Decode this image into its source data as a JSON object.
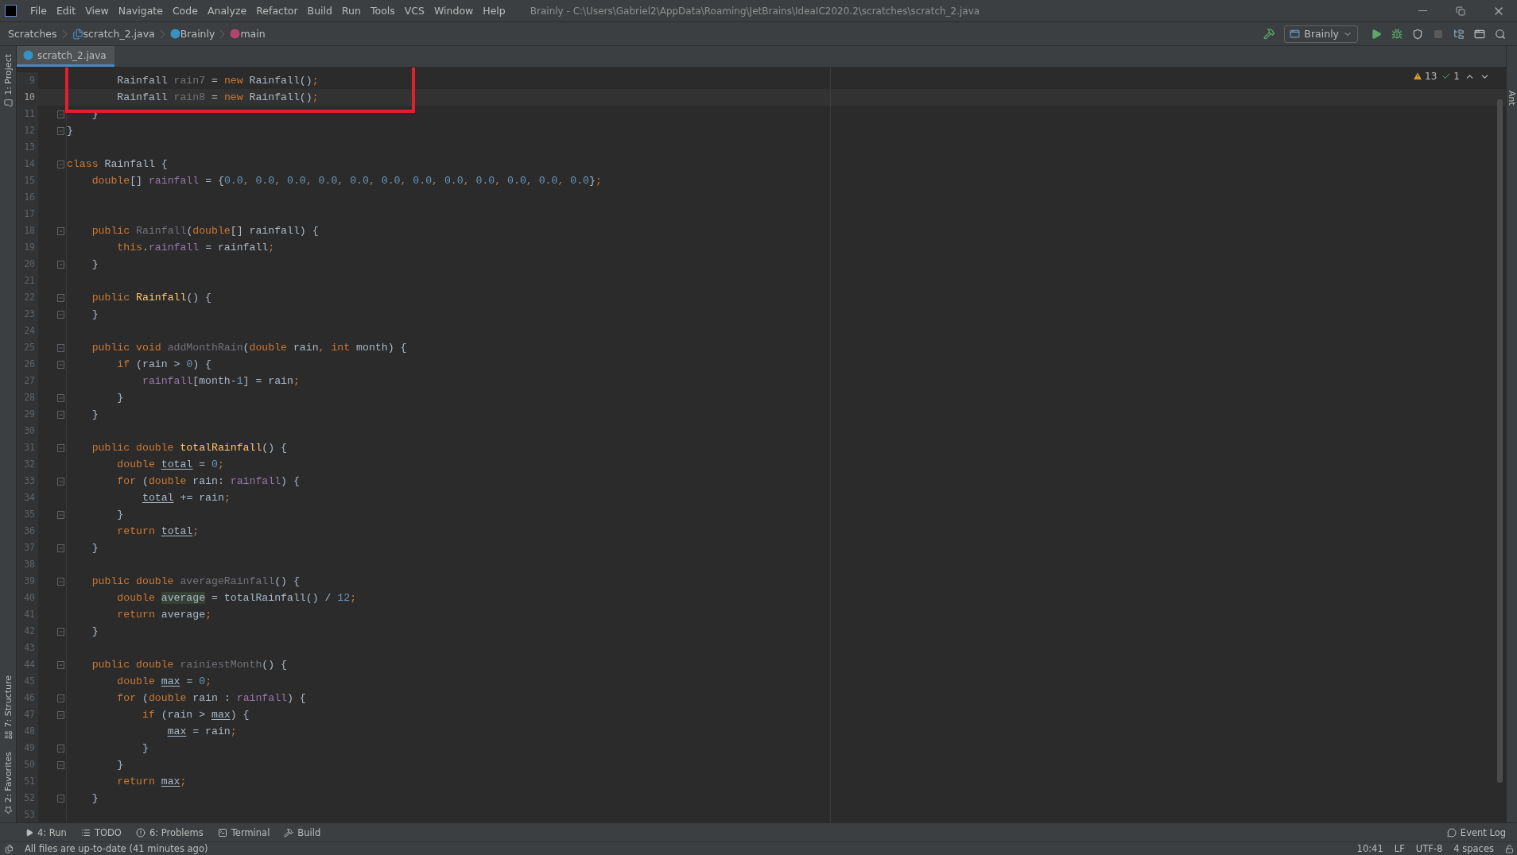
{
  "window": {
    "title": "Brainly - C:\\Users\\Gabriel2\\AppData\\Roaming\\JetBrains\\IdeaIC2020.2\\scratches\\scratch_2.java"
  },
  "menu": [
    "File",
    "Edit",
    "View",
    "Navigate",
    "Code",
    "Analyze",
    "Refactor",
    "Build",
    "Run",
    "Tools",
    "VCS",
    "Window",
    "Help"
  ],
  "breadcrumbs": [
    {
      "kind": "folder",
      "label": "Scratches"
    },
    {
      "kind": "file",
      "label": "scratch_2.java"
    },
    {
      "kind": "class",
      "label": "Brainly"
    },
    {
      "kind": "method",
      "label": "main"
    }
  ],
  "run_config": "Brainly",
  "tabs": [
    {
      "label": "scratch_2.java",
      "selected": true
    }
  ],
  "left_stripe": [
    {
      "kind": "top",
      "label": "1: Project"
    },
    {
      "kind": "bottom",
      "label": "7: Structure"
    },
    {
      "kind": "bottom",
      "label": "2: Favorites"
    }
  ],
  "right_stripe": [
    "Ant"
  ],
  "inspections": {
    "warnings": "13",
    "typos": "1"
  },
  "lines": [
    {
      "number": "9",
      "current": false,
      "fold": false,
      "tokens": [
        {
          "kind": "text",
          "text": "        Rainfall "
        },
        {
          "kind": "unused",
          "text": "rain7"
        },
        {
          "kind": "text",
          "text": " = "
        },
        {
          "kind": "keyword",
          "text": "new"
        },
        {
          "kind": "text",
          "text": " Rainfall()"
        },
        {
          "kind": "keyword",
          "text": ";"
        }
      ]
    },
    {
      "number": "10",
      "current": true,
      "fold": false,
      "tokens": [
        {
          "kind": "text",
          "text": "        Rainfall "
        },
        {
          "kind": "unused",
          "text": "rain8"
        },
        {
          "kind": "text",
          "text": " = "
        },
        {
          "kind": "keyword",
          "text": "new"
        },
        {
          "kind": "text",
          "text": " Rainfall()"
        },
        {
          "kind": "keyword",
          "text": ";"
        }
      ]
    },
    {
      "number": "11",
      "current": false,
      "fold": true,
      "tokens": [
        {
          "kind": "text",
          "text": "    }"
        }
      ]
    },
    {
      "number": "12",
      "current": false,
      "fold": true,
      "tokens": [
        {
          "kind": "text",
          "text": "}"
        }
      ]
    },
    {
      "number": "13",
      "current": false,
      "fold": false
    },
    {
      "number": "14",
      "current": false,
      "fold": true,
      "tokens": [
        {
          "kind": "keyword",
          "text": "class"
        },
        {
          "kind": "text",
          "text": " Rainfall {"
        }
      ]
    },
    {
      "number": "15",
      "current": false,
      "fold": false,
      "tokens": [
        {
          "kind": "keyword",
          "text": "    double"
        },
        {
          "kind": "text",
          "text": "[] "
        },
        {
          "kind": "field",
          "text": "rainfall"
        },
        {
          "kind": "text",
          "text": " = {"
        },
        {
          "kind": "number",
          "text": "0.0"
        },
        {
          "kind": "keyword",
          "text": ", "
        },
        {
          "kind": "number",
          "text": "0.0"
        },
        {
          "kind": "keyword",
          "text": ", "
        },
        {
          "kind": "number",
          "text": "0.0"
        },
        {
          "kind": "keyword",
          "text": ", "
        },
        {
          "kind": "number",
          "text": "0.0"
        },
        {
          "kind": "keyword",
          "text": ", "
        },
        {
          "kind": "number",
          "text": "0.0"
        },
        {
          "kind": "keyword",
          "text": ", "
        },
        {
          "kind": "number",
          "text": "0.0"
        },
        {
          "kind": "keyword",
          "text": ", "
        },
        {
          "kind": "number",
          "text": "0.0"
        },
        {
          "kind": "keyword",
          "text": ", "
        },
        {
          "kind": "number",
          "text": "0.0"
        },
        {
          "kind": "keyword",
          "text": ", "
        },
        {
          "kind": "number",
          "text": "0.0"
        },
        {
          "kind": "keyword",
          "text": ", "
        },
        {
          "kind": "number",
          "text": "0.0"
        },
        {
          "kind": "keyword",
          "text": ", "
        },
        {
          "kind": "number",
          "text": "0.0"
        },
        {
          "kind": "keyword",
          "text": ", "
        },
        {
          "kind": "number",
          "text": "0.0"
        },
        {
          "kind": "text",
          "text": "}"
        },
        {
          "kind": "keyword",
          "text": ";"
        }
      ]
    },
    {
      "number": "16",
      "current": false,
      "fold": false
    },
    {
      "number": "17",
      "current": false,
      "fold": false
    },
    {
      "number": "18",
      "current": false,
      "fold": true,
      "tokens": [
        {
          "kind": "keyword",
          "text": "    public "
        },
        {
          "kind": "unused",
          "text": "Rainfall"
        },
        {
          "kind": "text",
          "text": "("
        },
        {
          "kind": "keyword",
          "text": "double"
        },
        {
          "kind": "text",
          "text": "[] rainfall) {"
        }
      ]
    },
    {
      "number": "19",
      "current": false,
      "fold": false,
      "tokens": [
        {
          "kind": "keyword",
          "text": "        this"
        },
        {
          "kind": "text",
          "text": "."
        },
        {
          "kind": "field",
          "text": "rainfall"
        },
        {
          "kind": "text",
          "text": " = rainfall"
        },
        {
          "kind": "keyword",
          "text": ";"
        }
      ]
    },
    {
      "number": "20",
      "current": false,
      "fold": true,
      "tokens": [
        {
          "kind": "text",
          "text": "    }"
        }
      ]
    },
    {
      "number": "21",
      "current": false,
      "fold": false
    },
    {
      "number": "22",
      "current": false,
      "fold": true,
      "tokens": [
        {
          "kind": "keyword",
          "text": "    public "
        },
        {
          "kind": "method",
          "text": "Rainfall"
        },
        {
          "kind": "text",
          "text": "() {"
        }
      ]
    },
    {
      "number": "23",
      "current": false,
      "fold": true,
      "tokens": [
        {
          "kind": "text",
          "text": "    }"
        }
      ]
    },
    {
      "number": "24",
      "current": false,
      "fold": false
    },
    {
      "number": "25",
      "current": false,
      "fold": true,
      "tokens": [
        {
          "kind": "keyword",
          "text": "    public void "
        },
        {
          "kind": "unused",
          "text": "addMonthRain"
        },
        {
          "kind": "text",
          "text": "("
        },
        {
          "kind": "keyword",
          "text": "double"
        },
        {
          "kind": "text",
          "text": " rain"
        },
        {
          "kind": "keyword",
          "text": ", int"
        },
        {
          "kind": "text",
          "text": " month) {"
        }
      ]
    },
    {
      "number": "26",
      "current": false,
      "fold": true,
      "tokens": [
        {
          "kind": "keyword",
          "text": "        if"
        },
        {
          "kind": "text",
          "text": " (rain > "
        },
        {
          "kind": "number",
          "text": "0"
        },
        {
          "kind": "text",
          "text": ") {"
        }
      ]
    },
    {
      "number": "27",
      "current": false,
      "fold": false,
      "tokens": [
        {
          "kind": "field",
          "text": "            rainfall"
        },
        {
          "kind": "text",
          "text": "[month-"
        },
        {
          "kind": "number",
          "text": "1"
        },
        {
          "kind": "text",
          "text": "] = rain"
        },
        {
          "kind": "keyword",
          "text": ";"
        }
      ]
    },
    {
      "number": "28",
      "current": false,
      "fold": true,
      "tokens": [
        {
          "kind": "text",
          "text": "        }"
        }
      ]
    },
    {
      "number": "29",
      "current": false,
      "fold": true,
      "tokens": [
        {
          "kind": "text",
          "text": "    }"
        }
      ]
    },
    {
      "number": "30",
      "current": false,
      "fold": false
    },
    {
      "number": "31",
      "current": false,
      "fold": true,
      "tokens": [
        {
          "kind": "keyword",
          "text": "    public double "
        },
        {
          "kind": "method",
          "text": "totalRainfall"
        },
        {
          "kind": "text",
          "text": "() {"
        }
      ]
    },
    {
      "number": "32",
      "current": false,
      "fold": false,
      "tokens": [
        {
          "kind": "keyword",
          "text": "        double "
        },
        {
          "kind": "mutable",
          "text": "total"
        },
        {
          "kind": "text",
          "text": " = "
        },
        {
          "kind": "number",
          "text": "0"
        },
        {
          "kind": "keyword",
          "text": ";"
        }
      ]
    },
    {
      "number": "33",
      "current": false,
      "fold": true,
      "tokens": [
        {
          "kind": "keyword",
          "text": "        for"
        },
        {
          "kind": "text",
          "text": " ("
        },
        {
          "kind": "keyword",
          "text": "double"
        },
        {
          "kind": "text",
          "text": " rain: "
        },
        {
          "kind": "field",
          "text": "rainfall"
        },
        {
          "kind": "text",
          "text": ") {"
        }
      ]
    },
    {
      "number": "34",
      "current": false,
      "fold": false,
      "tokens": [
        {
          "kind": "mutable",
          "text": "            total"
        },
        {
          "kind": "text",
          "text": " += rain"
        },
        {
          "kind": "keyword",
          "text": ";"
        }
      ]
    },
    {
      "number": "35",
      "current": false,
      "fold": true,
      "tokens": [
        {
          "kind": "text",
          "text": "        }"
        }
      ]
    },
    {
      "number": "36",
      "current": false,
      "fold": false,
      "tokens": [
        {
          "kind": "keyword",
          "text": "        return "
        },
        {
          "kind": "mutable",
          "text": "total"
        },
        {
          "kind": "keyword",
          "text": ";"
        }
      ]
    },
    {
      "number": "37",
      "current": false,
      "fold": true,
      "tokens": [
        {
          "kind": "text",
          "text": "    }"
        }
      ]
    },
    {
      "number": "38",
      "current": false,
      "fold": false
    },
    {
      "number": "39",
      "current": false,
      "fold": true,
      "tokens": [
        {
          "kind": "keyword",
          "text": "    public double "
        },
        {
          "kind": "unused",
          "text": "averageRainfall"
        },
        {
          "kind": "text",
          "text": "() {"
        }
      ]
    },
    {
      "number": "40",
      "current": false,
      "fold": false,
      "tokens": [
        {
          "kind": "keyword",
          "text": "        double "
        },
        {
          "kind": "highlight",
          "text": "average"
        },
        {
          "kind": "text",
          "text": " = totalRainfall() / "
        },
        {
          "kind": "number",
          "text": "12"
        },
        {
          "kind": "keyword",
          "text": ";"
        }
      ]
    },
    {
      "number": "41",
      "current": false,
      "fold": false,
      "tokens": [
        {
          "kind": "keyword",
          "text": "        return"
        },
        {
          "kind": "text",
          "text": " average"
        },
        {
          "kind": "keyword",
          "text": ";"
        }
      ]
    },
    {
      "number": "42",
      "current": false,
      "fold": true,
      "tokens": [
        {
          "kind": "text",
          "text": "    }"
        }
      ]
    },
    {
      "number": "43",
      "current": false,
      "fold": false
    },
    {
      "number": "44",
      "current": false,
      "fold": true,
      "tokens": [
        {
          "kind": "keyword",
          "text": "    public double "
        },
        {
          "kind": "unused",
          "text": "rainiestMonth"
        },
        {
          "kind": "text",
          "text": "() {"
        }
      ]
    },
    {
      "number": "45",
      "current": false,
      "fold": false,
      "tokens": [
        {
          "kind": "keyword",
          "text": "        double "
        },
        {
          "kind": "mutable",
          "text": "max"
        },
        {
          "kind": "text",
          "text": " = "
        },
        {
          "kind": "number",
          "text": "0"
        },
        {
          "kind": "keyword",
          "text": ";"
        }
      ]
    },
    {
      "number": "46",
      "current": false,
      "fold": true,
      "tokens": [
        {
          "kind": "keyword",
          "text": "        for"
        },
        {
          "kind": "text",
          "text": " ("
        },
        {
          "kind": "keyword",
          "text": "double"
        },
        {
          "kind": "text",
          "text": " rain : "
        },
        {
          "kind": "field",
          "text": "rainfall"
        },
        {
          "kind": "text",
          "text": ") {"
        }
      ]
    },
    {
      "number": "47",
      "current": false,
      "fold": true,
      "tokens": [
        {
          "kind": "keyword",
          "text": "            if"
        },
        {
          "kind": "text",
          "text": " (rain > "
        },
        {
          "kind": "mutable",
          "text": "max"
        },
        {
          "kind": "text",
          "text": ") {"
        }
      ]
    },
    {
      "number": "48",
      "current": false,
      "fold": false,
      "tokens": [
        {
          "kind": "mutable",
          "text": "                max"
        },
        {
          "kind": "text",
          "text": " = rain"
        },
        {
          "kind": "keyword",
          "text": ";"
        }
      ]
    },
    {
      "number": "49",
      "current": false,
      "fold": true,
      "tokens": [
        {
          "kind": "text",
          "text": "            }"
        }
      ]
    },
    {
      "number": "50",
      "current": false,
      "fold": true,
      "tokens": [
        {
          "kind": "text",
          "text": "        }"
        }
      ]
    },
    {
      "number": "51",
      "current": false,
      "fold": false,
      "tokens": [
        {
          "kind": "keyword",
          "text": "        return "
        },
        {
          "kind": "mutable",
          "text": "max"
        },
        {
          "kind": "keyword",
          "text": ";"
        }
      ]
    },
    {
      "number": "52",
      "current": false,
      "fold": true,
      "tokens": [
        {
          "kind": "text",
          "text": "    }"
        }
      ]
    },
    {
      "number": "53",
      "current": false,
      "fold": false
    }
  ],
  "tool_windows": [
    {
      "kind": "run",
      "label": "4: Run"
    },
    {
      "kind": "todo",
      "label": "TODO"
    },
    {
      "kind": "problems",
      "label": "6: Problems"
    },
    {
      "kind": "terminal",
      "label": "Terminal"
    },
    {
      "kind": "build",
      "label": "Build"
    }
  ],
  "event_log": "Event Log",
  "status_bar": {
    "message": "All files are up-to-date (41 minutes ago)",
    "position": "10:41",
    "line_separator": "LF",
    "encoding": "UTF-8",
    "indent": "4 spaces"
  }
}
